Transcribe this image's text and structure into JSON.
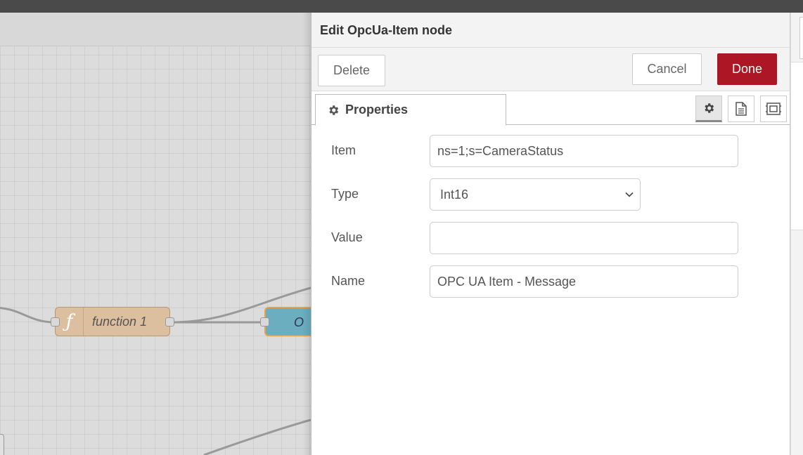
{
  "canvas": {
    "function_node": {
      "label": "function 1",
      "icon": "function-icon"
    },
    "opcua_node": {
      "label": "O"
    }
  },
  "tray": {
    "title": "Edit OpcUa-Item node",
    "toolbar": {
      "delete_label": "Delete",
      "cancel_label": "Cancel",
      "done_label": "Done"
    },
    "tabs": {
      "properties_label": "Properties",
      "icons": [
        "gear-icon",
        "document-icon",
        "appearance-icon"
      ]
    },
    "form": {
      "item": {
        "label": "Item",
        "value": "ns=1;s=CameraStatus",
        "placeholder": ""
      },
      "type": {
        "label": "Type",
        "selected": "Int16"
      },
      "value": {
        "label": "Value",
        "value": "",
        "placeholder": ""
      },
      "name": {
        "label": "Name",
        "value": "OPC UA Item - Message",
        "placeholder": ""
      }
    }
  },
  "colors": {
    "done_button": "#ad1625",
    "function_node": "#dbbf9f",
    "opcua_node": "#6aaec0",
    "selected_outline": "#e8a04a",
    "topbar": "#4a4a4a"
  }
}
